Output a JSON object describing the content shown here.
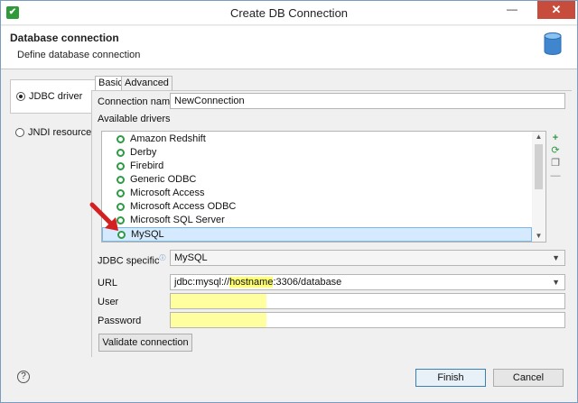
{
  "window": {
    "title": "Create DB Connection",
    "minimize_glyph": "—",
    "close_glyph": "✕",
    "app_icon_glyph": "✔"
  },
  "header": {
    "title": "Database connection",
    "subtitle": "Define database connection",
    "icon": "database-icon"
  },
  "connection_type": [
    {
      "label": "JDBC driver",
      "selected": true
    },
    {
      "label": "JNDI resource",
      "selected": false
    }
  ],
  "tabs": [
    {
      "label": "Basic",
      "active": true
    },
    {
      "label": "Advanced",
      "active": false
    }
  ],
  "form": {
    "connection_name_label": "Connection name",
    "connection_name_value": "NewConnection",
    "available_drivers_label": "Available drivers",
    "drivers": [
      "Amazon Redshift",
      "Derby",
      "Firebird",
      "Generic ODBC",
      "Microsoft Access",
      "Microsoft Access ODBC",
      "Microsoft SQL Server",
      "MySQL"
    ],
    "selected_driver": "MySQL",
    "jdbc_specific_label": "JDBC specific",
    "jdbc_specific_value": "MySQL",
    "url_label": "URL",
    "url_prefix": "jdbc:mysql://",
    "url_host": "hostname",
    "url_suffix": ":3306/database",
    "user_label": "User",
    "user_value": "",
    "password_label": "Password",
    "password_value": "",
    "validate_button": "Validate connection"
  },
  "list_tools": [
    "add-icon",
    "refresh-icon",
    "copy-icon",
    "remove-icon"
  ],
  "footer": {
    "finish_button": "Finish",
    "cancel_button": "Cancel",
    "help_glyph": "?"
  },
  "colors": {
    "close_button": "#c74c3c",
    "field_highlight": "#ffff9f",
    "selection": "#d5eaff",
    "driver_icon": "#2d9a45",
    "arrow": "#d42020"
  }
}
